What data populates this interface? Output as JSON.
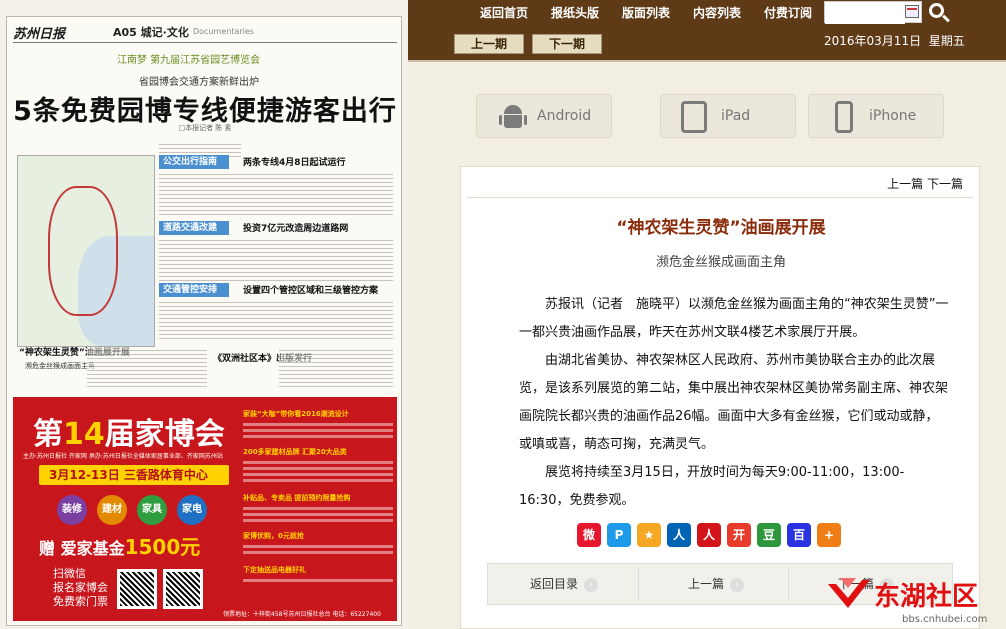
{
  "nav": {
    "items": [
      "返回首页",
      "报纸头版",
      "版面列表",
      "内容列表",
      "付费订阅"
    ],
    "search_value": "",
    "prev_issue": "上一期",
    "next_issue": "下一期",
    "date": "2016年03月11日",
    "weekday": "星期五"
  },
  "devices": [
    "Android",
    "iPad",
    "iPhone"
  ],
  "newspaper": {
    "logo": "苏州日报",
    "page": "A05 城记·文化",
    "page_en": "Documentaries",
    "banner": "江南梦 第九届江苏省园艺博览会",
    "kicker": "省园博会交通方案新鲜出炉",
    "headline": "5条免费园博专线便捷游客出行",
    "byline": "□本报记者 陈 素",
    "sections": [
      "公交出行指南",
      "道路交通改建",
      "交通管控安排"
    ],
    "subheads": [
      "两条专线4月8日起试运行",
      "投资7亿元改造周边道路网",
      "设置四个管控区域和三级管控方案"
    ],
    "side_title": "“神农架生灵赞”油画展开展",
    "side_sub": "濒危金丝猴成画面主角",
    "side_title2": "《双洲社区本》出版发行",
    "ad": {
      "title_pre": "第",
      "title_num": "14",
      "title_post": "届家博会",
      "sub": "主办:苏州日报社 齐家网  承办:苏州日报社全媒体家居事业部、齐家网苏州站",
      "date": "3月12-13日  三香路体育中心",
      "circles": [
        "装修",
        "建材",
        "家具",
        "家电"
      ],
      "fund_pre": "赠 爱家基金",
      "fund_amt": "1500元",
      "scan": [
        "扫微信",
        "报名家博会",
        "免费索门票"
      ],
      "right_headers": [
        "家装“大咖”带你看2016潮流设计",
        "200多家建材品牌 汇聚20大品类",
        "补贴品、专卖品 提前预约限量抢购",
        "家博优购，0元就抢",
        "下定抽送品电器好礼"
      ],
      "footer": "领票地址：十梓街458号苏州日报社总台  电话：65227400"
    }
  },
  "article": {
    "prev": "上一篇",
    "next": "下一篇",
    "title": "“神农架生灵赞”油画展开展",
    "subtitle": "濒危金丝猴成画面主角",
    "paragraphs": [
      "苏报讯（记者　施晓平）以濒危金丝猴为画面主角的“神农架生灵赞”一一都兴贵油画作品展，昨天在苏州文联4楼艺术家展厅开展。",
      "由湖北省美协、神农架林区人民政府、苏州市美协联合主办的此次展览，是该系列展览的第二站，集中展出神农架林区美协常务副主席、神农架画院院长都兴贵的油画作品26幅。画面中大多有金丝猴，它们或动或静，或嗔或喜，萌态可掬，充满灵气。",
      "展览将持续至3月15日，开放时间为每天9:00-11:00，13:00-16:30，免费参观。"
    ],
    "share": [
      {
        "name": "weibo",
        "color": "#e6162d",
        "glyph": "微"
      },
      {
        "name": "qzone",
        "color": "#1e9be8",
        "glyph": "P"
      },
      {
        "name": "qq-star",
        "color": "#f5a623",
        "glyph": "★"
      },
      {
        "name": "renren",
        "color": "#0064b4",
        "glyph": "人"
      },
      {
        "name": "people",
        "color": "#d3141b",
        "glyph": "人"
      },
      {
        "name": "kaixin",
        "color": "#e73b2b",
        "glyph": "开"
      },
      {
        "name": "douban",
        "color": "#2e963d",
        "glyph": "豆"
      },
      {
        "name": "baidu",
        "color": "#2932e1",
        "glyph": "百"
      },
      {
        "name": "more",
        "color": "#f07e16",
        "glyph": "+"
      }
    ],
    "bottom": [
      "返回目录",
      "上一篇",
      "下一篇"
    ]
  },
  "watermark": {
    "text": "东湖社区",
    "url": "bbs.cnhubei.com"
  },
  "colors": {
    "nav_bg": "#5e3a17",
    "title": "#8a2d0c",
    "ad_red": "#c8161d"
  }
}
